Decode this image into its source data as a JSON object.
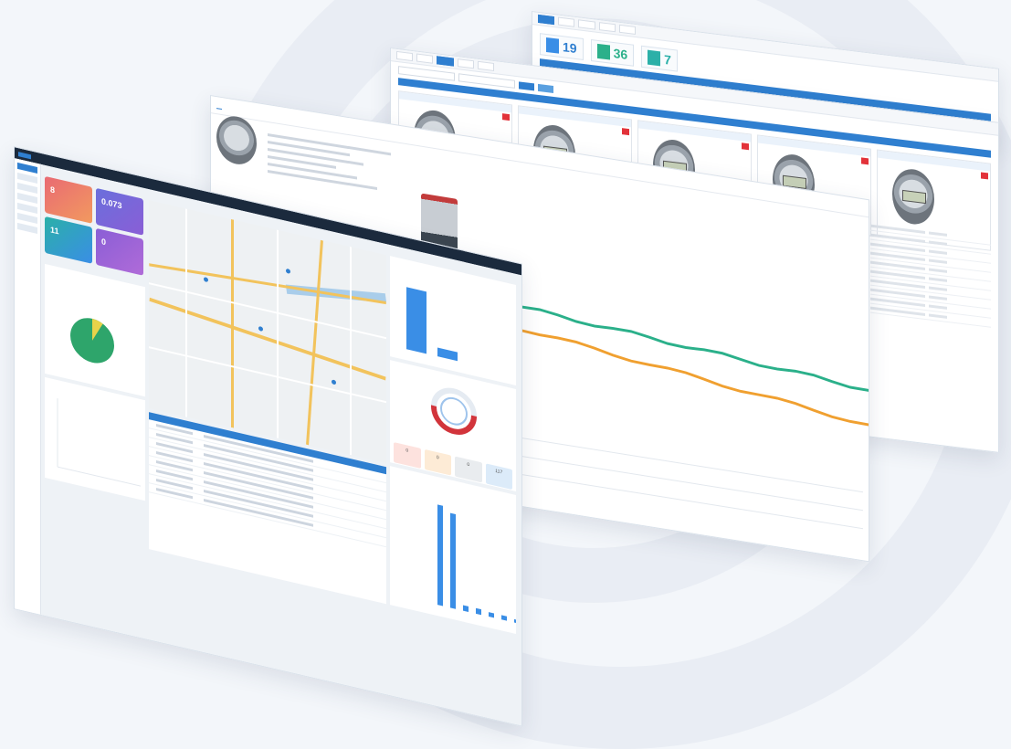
{
  "colors": {
    "primary": "#2f7fd0",
    "alert": "#e2323a",
    "pie_main": "#2ea56b",
    "pie_slice": "#e8d34a",
    "line_green": "#2bb08a",
    "line_orange": "#f0a030",
    "bar_blue": "#3a8ee6",
    "donut_red": "#d2343b",
    "card_colors": [
      "#e96a73",
      "#6a6fdc",
      "#2bb0a8",
      "#8a5ed6"
    ]
  },
  "window4": {
    "cards": [
      {
        "value": "8",
        "color_index": 0
      },
      {
        "value": "0.073",
        "color_index": 1
      },
      {
        "value": "11",
        "color_index": 2
      },
      {
        "value": "0",
        "color_index": 3
      }
    ],
    "summary": [
      {
        "value": "0"
      },
      {
        "value": "0"
      },
      {
        "value": "0"
      },
      {
        "value": "117"
      }
    ],
    "pie_share_main": 0.92,
    "bar_values_right": [
      0.85,
      0.12
    ],
    "bar_values_bottom": [
      0.9,
      0.85,
      0.05,
      0.05,
      0.04,
      0.04,
      0.03,
      0.03
    ]
  },
  "window1": {
    "stats": [
      {
        "num": "19"
      },
      {
        "num": "36"
      },
      {
        "num": "7"
      }
    ]
  }
}
